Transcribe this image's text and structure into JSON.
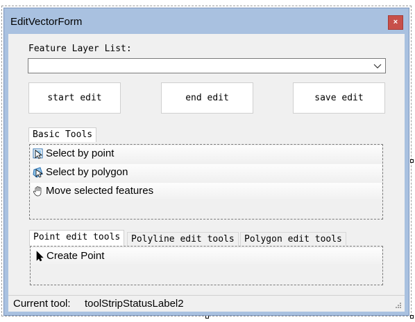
{
  "window": {
    "title": "EditVectorForm",
    "close_glyph": "×"
  },
  "layer": {
    "label": "Feature Layer List:",
    "selected_value": ""
  },
  "buttons": {
    "start_edit": "start edit",
    "end_edit": "end edit",
    "save_edit": "save edit"
  },
  "basic_tools": {
    "title": "Basic Tools",
    "items": [
      {
        "label": "Select by point",
        "icon": "select-by-point-icon"
      },
      {
        "label": "Select by polygon",
        "icon": "select-by-polygon-icon"
      },
      {
        "label": "Move selected features",
        "icon": "pan-hand-icon"
      }
    ]
  },
  "edit_tabs": {
    "tabs": [
      {
        "label": "Point edit tools",
        "active": true
      },
      {
        "label": "Polyline edit tools",
        "active": false
      },
      {
        "label": "Polygon edit tools",
        "active": false
      }
    ],
    "items": [
      {
        "label": "Create Point",
        "icon": "arrow-cursor-icon"
      }
    ]
  },
  "status": {
    "label": "Current tool:",
    "value": "toolStripStatusLabel2"
  },
  "colors": {
    "frame": "#a9c1e0",
    "close_button": "#c7504a",
    "client": "#f0f0f0"
  }
}
